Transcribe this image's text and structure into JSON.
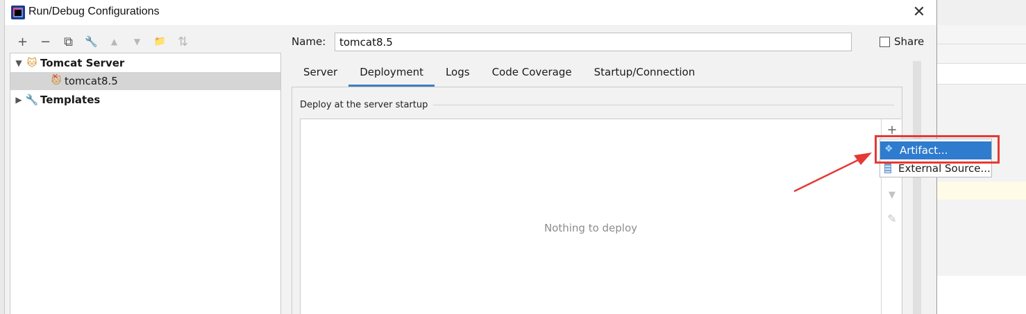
{
  "window": {
    "title": "Run/Debug Configurations",
    "close_glyph": "✕"
  },
  "toolbar": {
    "buttons": [
      {
        "name": "add-config-button",
        "glyph": "+"
      },
      {
        "name": "remove-config-button",
        "glyph": "−"
      },
      {
        "name": "copy-config-button",
        "glyph": "⧉"
      },
      {
        "name": "edit-defaults-button",
        "glyph": "🔧"
      },
      {
        "name": "move-up-button",
        "glyph": "▲"
      },
      {
        "name": "move-down-button",
        "glyph": "▼"
      },
      {
        "name": "new-folder-button",
        "glyph": "📁"
      },
      {
        "name": "sort-button",
        "glyph": "⇅"
      }
    ]
  },
  "tree": {
    "tomcat_server": "Tomcat Server",
    "tomcat_instance": "tomcat8.5",
    "templates": "Templates",
    "expanded_arrow": "▼",
    "collapsed_arrow": "▶"
  },
  "form": {
    "name_label": "Name:",
    "name_value": "tomcat8.5",
    "share_label": "Share"
  },
  "tabs": [
    {
      "label": "Server",
      "active": false
    },
    {
      "label": "Deployment",
      "active": true
    },
    {
      "label": "Logs",
      "active": false
    },
    {
      "label": "Code Coverage",
      "active": false
    },
    {
      "label": "Startup/Connection",
      "active": false
    }
  ],
  "deployment": {
    "section_title": "Deploy at the server startup",
    "empty_text": "Nothing to deploy"
  },
  "popup_menu": {
    "items": [
      {
        "label": "Artifact...",
        "icon": "artifact-icon",
        "highlighted": true
      },
      {
        "label": "External Source...",
        "icon": "external-source-icon",
        "highlighted": false
      }
    ]
  },
  "colors": {
    "accent": "#2f7bce",
    "annotation": "#e53935",
    "tab_underline": "#3f7fbf"
  }
}
